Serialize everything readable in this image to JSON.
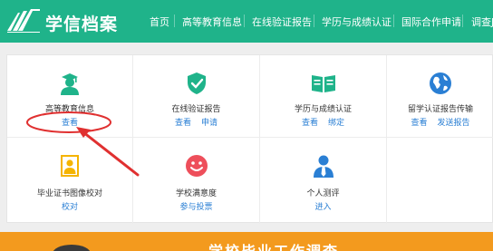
{
  "header": {
    "logo_text": "学信档案",
    "nav": [
      "首页",
      "高等教育信息",
      "在线验证报告",
      "学历与成绩认证",
      "国际合作申请",
      "调查J"
    ]
  },
  "grid": {
    "row1": [
      {
        "title": "高等教育信息",
        "links": [
          "查看"
        ],
        "icon": "graduate-icon"
      },
      {
        "title": "在线验证报告",
        "links": [
          "查看",
          "申请"
        ],
        "icon": "shield-check-icon"
      },
      {
        "title": "学历与成绩认证",
        "links": [
          "查看",
          "绑定"
        ],
        "icon": "certificate-book-icon"
      },
      {
        "title": "留学认证报告传输",
        "links": [
          "查看",
          "发送报告"
        ],
        "icon": "globe-icon"
      }
    ],
    "row2": [
      {
        "title": "毕业证书图像校对",
        "links": [
          "校对"
        ],
        "icon": "id-photo-icon"
      },
      {
        "title": "学校满意度",
        "links": [
          "参与投票"
        ],
        "icon": "smiley-icon"
      },
      {
        "title": "个人测评",
        "links": [
          "进入"
        ],
        "icon": "person-tie-icon"
      }
    ]
  },
  "banner": {
    "text": "学校毕业工作调查"
  },
  "colors": {
    "brand": "#1fb38a",
    "link": "#2a7fd4",
    "annotation": "#e03030",
    "banner": "#f39a1e"
  }
}
